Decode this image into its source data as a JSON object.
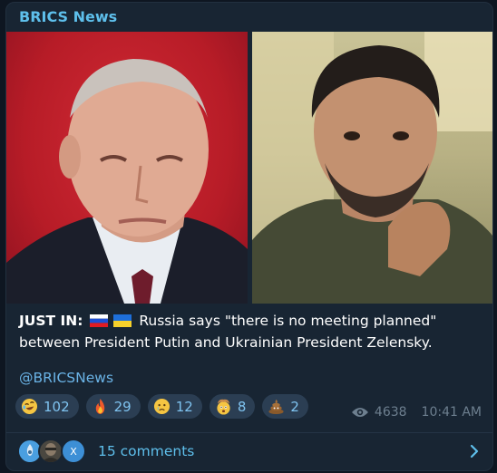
{
  "channel": {
    "name": "BRICS News"
  },
  "message": {
    "prefix": "JUST IN:",
    "text": "Russia says \"there is no meeting planned\" between President Putin and Ukrainian President Zelensky.",
    "handle": "@BRICSNews"
  },
  "reactions": [
    {
      "emoji": "rofl-emoji",
      "count": "102"
    },
    {
      "emoji": "fire-emoji",
      "count": "29"
    },
    {
      "emoji": "crying-face-emoji",
      "count": "12"
    },
    {
      "emoji": "exploding-head-emoji",
      "count": "8"
    },
    {
      "emoji": "poo-emoji",
      "count": "2"
    }
  ],
  "meta": {
    "views": "4638",
    "time": "10:41 AM"
  },
  "comments": {
    "label": "15 comments",
    "avatar_letter": "X"
  },
  "colors": {
    "accent": "#5ebfeb",
    "card_bg": "#182533",
    "reaction_bg": "#2b3e53"
  }
}
